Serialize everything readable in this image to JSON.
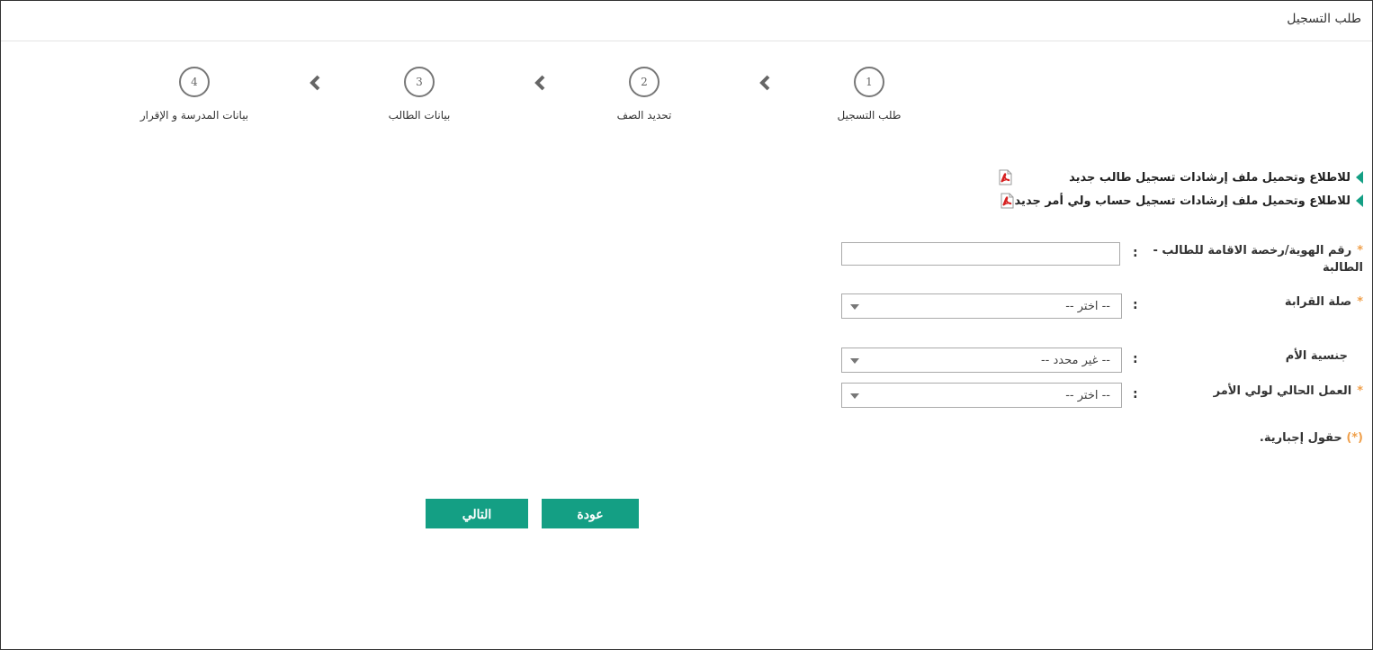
{
  "header": {
    "title": "طلب التسجيل"
  },
  "wizard": {
    "steps": [
      {
        "number": "1",
        "label": "طلب التسجيل"
      },
      {
        "number": "2",
        "label": "تحديد الصف"
      },
      {
        "number": "3",
        "label": "بيانات الطالب"
      },
      {
        "number": "4",
        "label": "بيانات المدرسة و الإقرار"
      }
    ]
  },
  "links": [
    {
      "text": "للاطلاع وتحميل ملف إرشادات تسجيل طالب جديد",
      "icon": "pdf-icon"
    },
    {
      "text": "للاطلاع وتحميل ملف إرشادات تسجيل حساب ولي أمر جديد",
      "icon": "pdf-icon"
    }
  ],
  "form": {
    "required_marker": "*",
    "colon": ":",
    "id_field": {
      "label": "رقم الهوية/رخصة الاقامة للطالب - الطالبة",
      "value": ""
    },
    "relation_field": {
      "label": "صلة القرابة",
      "selected": "-- اختر --"
    },
    "mother_nationality_field": {
      "label": "جنسية الأم",
      "selected": "-- غير محدد --"
    },
    "guardian_job_field": {
      "label": "العمل الحالي لولي الأمر",
      "selected": "-- اختر --"
    },
    "required_note": {
      "marker": "(*)",
      "text": " حقول إجبارية."
    }
  },
  "buttons": {
    "back": "عودة",
    "next": "التالي"
  },
  "colors": {
    "accent": "#149f84",
    "required": "#f0a04b"
  }
}
